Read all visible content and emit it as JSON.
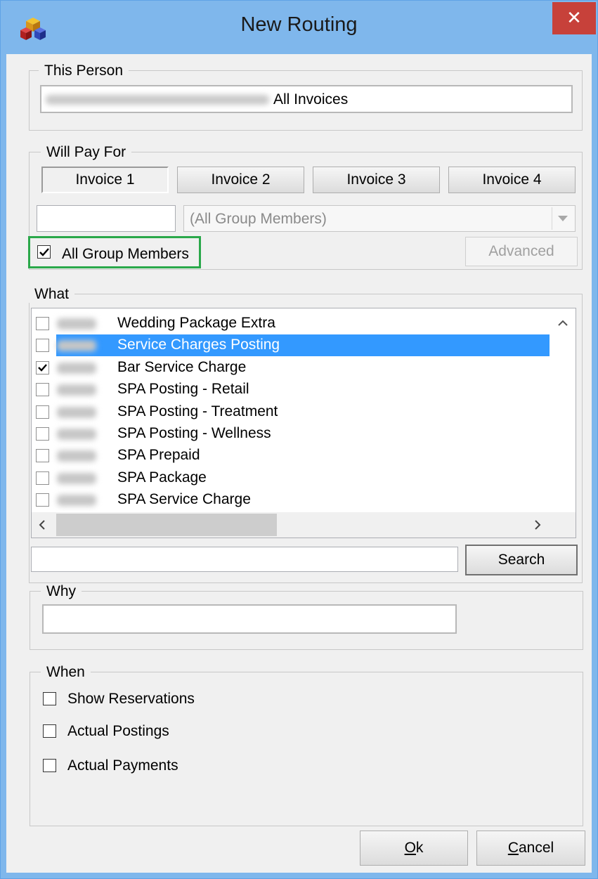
{
  "window": {
    "title": "New Routing",
    "close_glyph": "✕"
  },
  "this_person": {
    "legend": "This Person",
    "value_suffix": "All Invoices"
  },
  "will_pay_for": {
    "legend": "Will Pay For",
    "invoices": [
      "Invoice 1",
      "Invoice 2",
      "Invoice 3",
      "Invoice 4"
    ],
    "selected_invoice": "Invoice 1",
    "room_field_value": "",
    "group_combo_value": "(All Group Members)",
    "all_group_members_label": "All Group Members",
    "all_group_members_checked": true,
    "advanced_label": "Advanced"
  },
  "what": {
    "legend": "What",
    "items": [
      {
        "name": "Wedding Package Extra",
        "checked": false,
        "selected": false
      },
      {
        "name": "Service Charges Posting",
        "checked": false,
        "selected": true
      },
      {
        "name": "Bar Service Charge",
        "checked": true,
        "selected": false
      },
      {
        "name": "SPA Posting - Retail",
        "checked": false,
        "selected": false
      },
      {
        "name": "SPA Posting - Treatment",
        "checked": false,
        "selected": false
      },
      {
        "name": "SPA Posting - Wellness",
        "checked": false,
        "selected": false
      },
      {
        "name": "SPA Prepaid",
        "checked": false,
        "selected": false
      },
      {
        "name": "SPA Package",
        "checked": false,
        "selected": false
      },
      {
        "name": "SPA Service Charge",
        "checked": false,
        "selected": false
      }
    ],
    "search_value": "",
    "search_label": "Search"
  },
  "why": {
    "legend": "Why",
    "value": ""
  },
  "when": {
    "legend": "When",
    "options": [
      {
        "label": "Show Reservations",
        "checked": false
      },
      {
        "label": "Actual Postings",
        "checked": false
      },
      {
        "label": "Actual Payments",
        "checked": false
      }
    ]
  },
  "footer": {
    "ok_label_accel": "O",
    "ok_label_rest": "k",
    "cancel_label_accel": "C",
    "cancel_label_rest": "ancel"
  },
  "colors": {
    "highlight": "#3399ff",
    "focus_outline": "#2aa84a",
    "title_bar": "#7fb7ec",
    "close_button": "#c7413a"
  },
  "icons": {
    "app": "colored-cubes-icon",
    "close": "close-icon",
    "combo": "chevron-down-icon",
    "scroll_up": "chevron-up-icon",
    "scroll_left": "chevron-left-icon",
    "scroll_right": "chevron-right-icon"
  }
}
